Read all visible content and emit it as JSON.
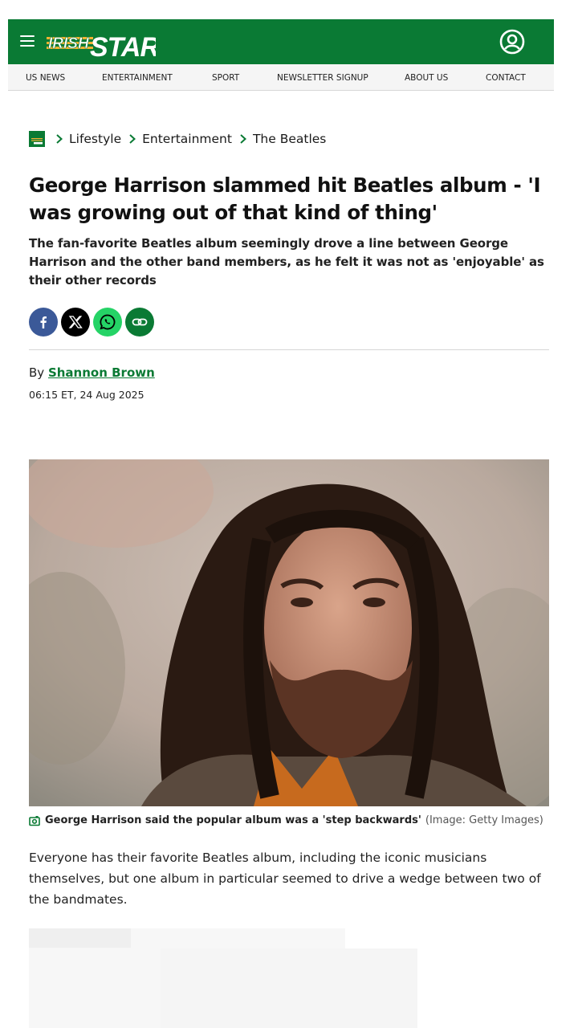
{
  "header": {
    "logo": {
      "word1": "IRISH",
      "word2": "STAR"
    },
    "menu_icon": "hamburger-icon",
    "account_icon": "user-circle-icon",
    "brand_color": "#0a7a34"
  },
  "nav": {
    "items": [
      {
        "label": "US NEWS"
      },
      {
        "label": "ENTERTAINMENT"
      },
      {
        "label": "SPORT"
      },
      {
        "label": "NEWSLETTER SIGNUP"
      },
      {
        "label": "ABOUT US"
      },
      {
        "label": "CONTACT"
      }
    ]
  },
  "breadcrumb": {
    "items": [
      {
        "label": "Lifestyle"
      },
      {
        "label": "Entertainment"
      },
      {
        "label": "The Beatles"
      }
    ]
  },
  "article": {
    "headline": "George Harrison slammed hit Beatles album - 'I was growing out of that kind of thing'",
    "standfirst": "The fan-favorite Beatles album seemingly drove a line between George Harrison and the other band members, as he felt it was not as 'enjoyable' as their other records",
    "share": [
      "facebook-icon",
      "x-icon",
      "whatsapp-icon",
      "link-icon"
    ],
    "byline_prefix": "By",
    "author": "Shannon Brown",
    "timestamp": "06:15 ET, 24 Aug 2025",
    "image_caption": "George Harrison said the popular album was a 'step backwards'",
    "image_credit": "(Image: Getty Images)",
    "body_first_paragraph": "Everyone has their favorite Beatles album, including the iconic musicians themselves, but one album in particular seemed to drive a wedge between two of the bandmates."
  }
}
